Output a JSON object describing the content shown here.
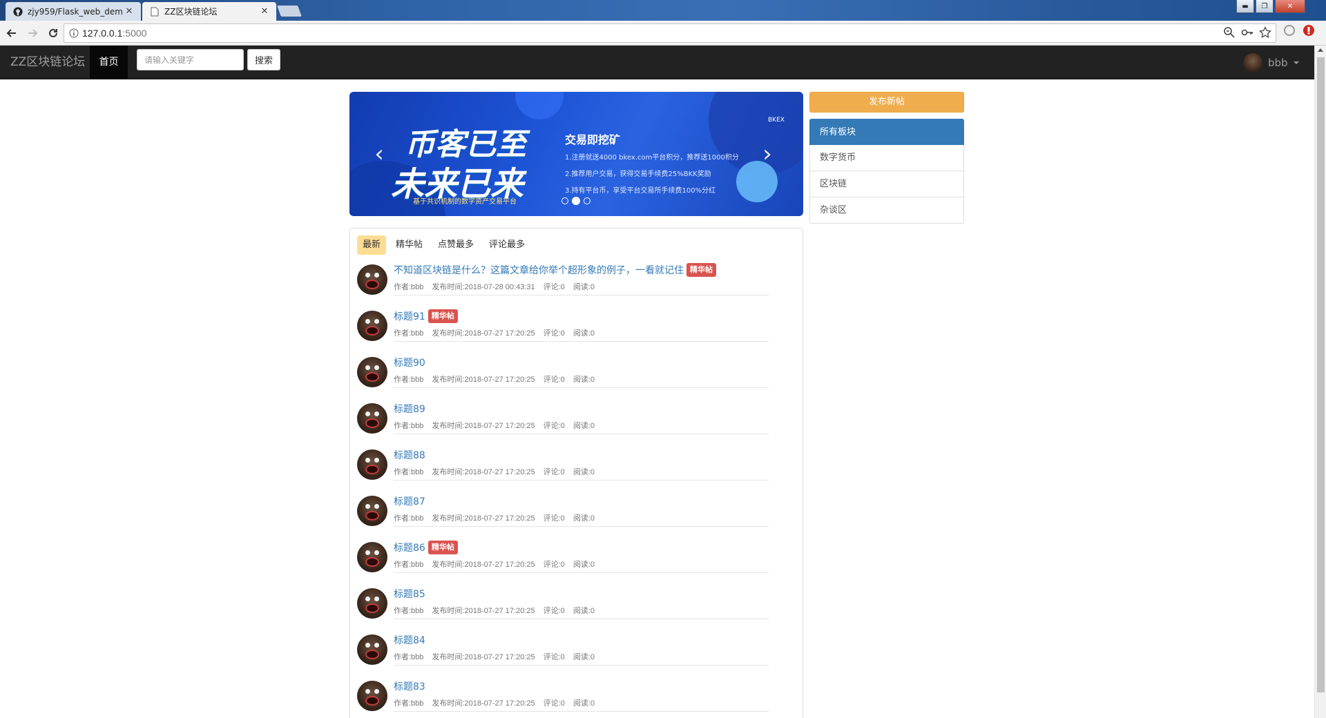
{
  "browser": {
    "tabs": [
      {
        "title": "zjy959/Flask_web_dem",
        "icon": "github-icon"
      },
      {
        "title": "ZZ区块链论坛",
        "icon": "page-icon"
      }
    ],
    "url_host": "127.0.0.1",
    "url_port": ":5000"
  },
  "navbar": {
    "brand": "ZZ区块链论坛",
    "home": "首页",
    "search_placeholder": "请输入关键字",
    "search_button": "搜索",
    "username": "bbb"
  },
  "banner": {
    "headline_1": "币客已至",
    "headline_2": "未来已来",
    "tagline": "基于共识机制的数字资产交易平台",
    "right_title": "交易即挖矿",
    "line_1": "1.注册就送4000 bkex.com平台积分，推荐送1000积分",
    "line_2": "2.推荐用户交易，获得交易手续费25%BKK奖励",
    "line_3": "3.持有平台币，享受平台交易所手续费100%分红",
    "brand_mark": "BKEX",
    "active_slide": 2,
    "slide_count": 3
  },
  "sort_tabs": [
    "最新",
    "精华帖",
    "点赞最多",
    "评论最多"
  ],
  "active_sort": 0,
  "posts": [
    {
      "title": "不知道区块链是什么？这篇文章给你举个超形象的例子，一看就记住",
      "featured": true,
      "author": "作者:bbb",
      "time": "发布时间:2018-07-28 00:43:31",
      "comments": "评论:0",
      "reads": "阅读:0"
    },
    {
      "title": "标题91",
      "featured": true,
      "author": "作者:bbb",
      "time": "发布时间:2018-07-27 17:20:25",
      "comments": "评论:0",
      "reads": "阅读:0"
    },
    {
      "title": "标题90",
      "featured": false,
      "author": "作者:bbb",
      "time": "发布时间:2018-07-27 17:20:25",
      "comments": "评论:0",
      "reads": "阅读:0"
    },
    {
      "title": "标题89",
      "featured": false,
      "author": "作者:bbb",
      "time": "发布时间:2018-07-27 17:20:25",
      "comments": "评论:0",
      "reads": "阅读:0"
    },
    {
      "title": "标题88",
      "featured": false,
      "author": "作者:bbb",
      "time": "发布时间:2018-07-27 17:20:25",
      "comments": "评论:0",
      "reads": "阅读:0"
    },
    {
      "title": "标题87",
      "featured": false,
      "author": "作者:bbb",
      "time": "发布时间:2018-07-27 17:20:25",
      "comments": "评论:0",
      "reads": "阅读:0"
    },
    {
      "title": "标题86",
      "featured": true,
      "author": "作者:bbb",
      "time": "发布时间:2018-07-27 17:20:25",
      "comments": "评论:0",
      "reads": "阅读:0"
    },
    {
      "title": "标题85",
      "featured": false,
      "author": "作者:bbb",
      "time": "发布时间:2018-07-27 17:20:25",
      "comments": "评论:0",
      "reads": "阅读:0"
    },
    {
      "title": "标题84",
      "featured": false,
      "author": "作者:bbb",
      "time": "发布时间:2018-07-27 17:20:25",
      "comments": "评论:0",
      "reads": "阅读:0"
    },
    {
      "title": "标题83",
      "featured": false,
      "author": "作者:bbb",
      "time": "发布时间:2018-07-27 17:20:25",
      "comments": "评论:0",
      "reads": "阅读:0"
    }
  ],
  "featured_badge": "精华帖",
  "sidebar": {
    "publish_button": "发布新帖",
    "boards": [
      "所有板块",
      "数字货币",
      "区块链",
      "杂谈区"
    ]
  },
  "colors": {
    "link": "#337ab7",
    "badge": "#d9534f",
    "publish": "#f0ad4e",
    "active_board": "#337ab7",
    "navbar": "#222222",
    "active_sort_tab": "#fddd94"
  }
}
